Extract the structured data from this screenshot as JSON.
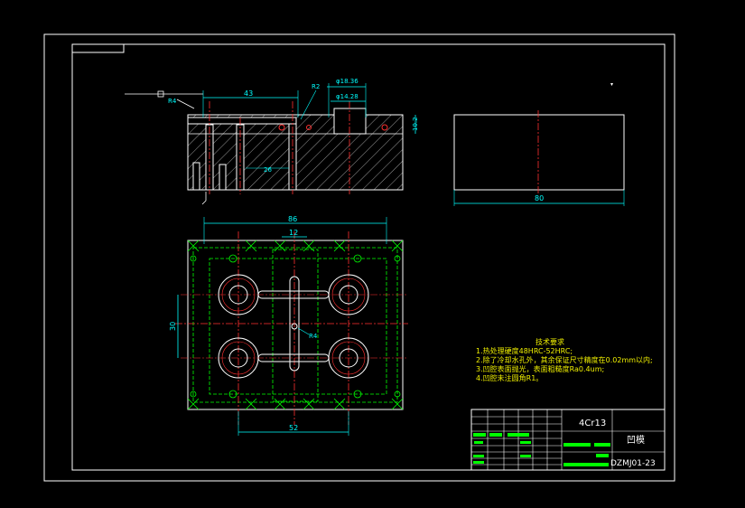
{
  "dimensions": {
    "width_43": "43",
    "dia_18_36": "φ18.36",
    "dia_14_28": "φ14.28",
    "r2": "R2",
    "h10_2": "10.2",
    "r4_top": "R4",
    "d26": "26",
    "w80": "80",
    "w86": "86",
    "w12": "12",
    "h30": "30",
    "r4_plan": "R4",
    "w52": "52"
  },
  "notes": {
    "title": "技术要求",
    "items": [
      "1.热处理硬度48HRC-52HRC;",
      "2.除了冷却水孔外，其余保证尺寸精度在0.02mm以内;",
      "3.凹腔表面抛光，表面粗糙度Ra0.4um;",
      "4.凹腔未注圆角R1。"
    ]
  },
  "title_block": {
    "material": "4Cr13",
    "part_name": "凹模",
    "drawing_no": "DZMJ01-23"
  },
  "colors": {
    "background": "#000000",
    "outline": "#ffffff",
    "dimension": "#00ffff",
    "center_line": "#ff3030",
    "hidden_line": "#00ff00",
    "notes": "#f0f000"
  }
}
